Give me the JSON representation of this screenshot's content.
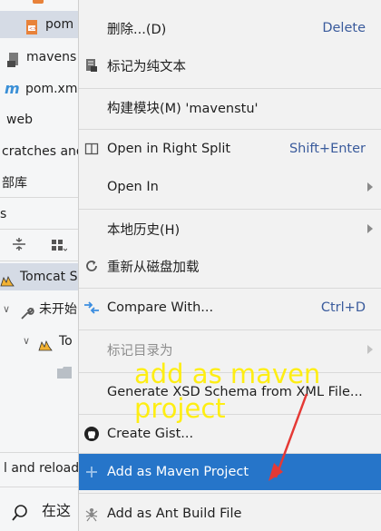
{
  "left_panel": {
    "rows": [
      {
        "text": "pom"
      },
      {
        "text": "mavens"
      },
      {
        "text": "pom.xm"
      },
      {
        "text": "web"
      },
      {
        "text": "cratches and"
      },
      {
        "text": "部库"
      },
      {
        "text": "s"
      },
      {
        "text": "Tomcat S"
      },
      {
        "text": "未开始"
      },
      {
        "text": "To"
      },
      {
        "text": "l and reload"
      },
      {
        "text": "在这"
      }
    ]
  },
  "context_menu": {
    "items": [
      {
        "label": "删除...(D)",
        "shortcut": "Delete"
      },
      {
        "label": "标记为纯文本",
        "shortcut": ""
      },
      {
        "label": "构建模块(M) 'mavenstu'",
        "shortcut": ""
      },
      {
        "label": "Open in Right Split",
        "shortcut": "Shift+Enter"
      },
      {
        "label": "Open In",
        "shortcut": ""
      },
      {
        "label": "本地历史(H)",
        "shortcut": ""
      },
      {
        "label": "重新从磁盘加载",
        "shortcut": ""
      },
      {
        "label": "Compare With...",
        "shortcut": "Ctrl+D"
      },
      {
        "label": "标记目录为",
        "shortcut": ""
      },
      {
        "label": "Generate XSD Schema from XML File...",
        "shortcut": ""
      },
      {
        "label": "Create Gist...",
        "shortcut": ""
      },
      {
        "label": "Add as Maven Project",
        "shortcut": ""
      },
      {
        "label": "Add as Ant Build File",
        "shortcut": ""
      }
    ]
  },
  "annotation": {
    "text": "add as maven project",
    "color": "#ffee00",
    "arrow_color": "#e53935"
  },
  "colors": {
    "menu_bg": "#f2f2f2",
    "highlight": "#2675c9",
    "shortcut": "#3a5b9c",
    "disabled": "#8e8e8e"
  }
}
